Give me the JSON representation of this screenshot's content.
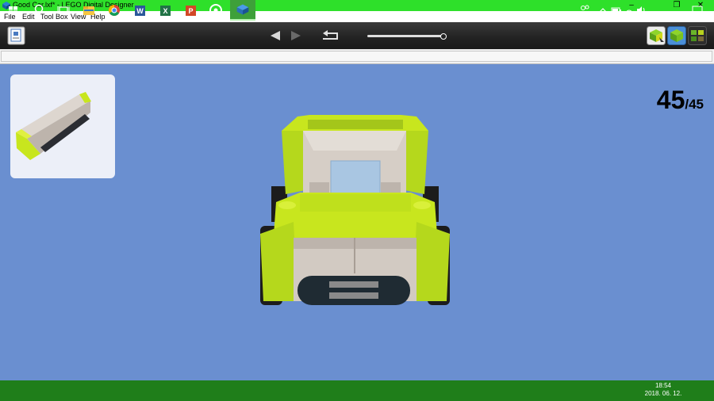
{
  "window": {
    "title": "Good Car.lxf* - LEGO Digital Designer",
    "controls": [
      "minimize",
      "restore",
      "close"
    ]
  },
  "menu": {
    "items": [
      "File",
      "Edit",
      "Tool Box",
      "View",
      "Help"
    ]
  },
  "toolbar": {
    "icons": [
      "building-guide-icon",
      "previous-step-icon",
      "next-step-icon",
      "rewind-icon",
      "build-mode-icon",
      "view-mode-icon",
      "building-guide-mode-icon"
    ]
  },
  "step": {
    "current": "45",
    "total": "/45",
    "progress": 1.0
  },
  "taskbar": {
    "apps": [
      "start-icon",
      "search-icon",
      "task-view-icon",
      "file-explorer-icon",
      "chrome-icon",
      "word-icon",
      "excel-icon",
      "powerpoint-icon",
      "groove-icon",
      "lego-digital-designer-icon"
    ],
    "clock_time": "18:54",
    "clock_date": "2018. 06. 12."
  },
  "colors": {
    "title_bar": "#2ee02a",
    "canvas": "#6a8fd0",
    "taskbar": "#1f7e1a",
    "brick_lime": "#b5dc1c",
    "brick_gray": "#cfc8c0"
  }
}
